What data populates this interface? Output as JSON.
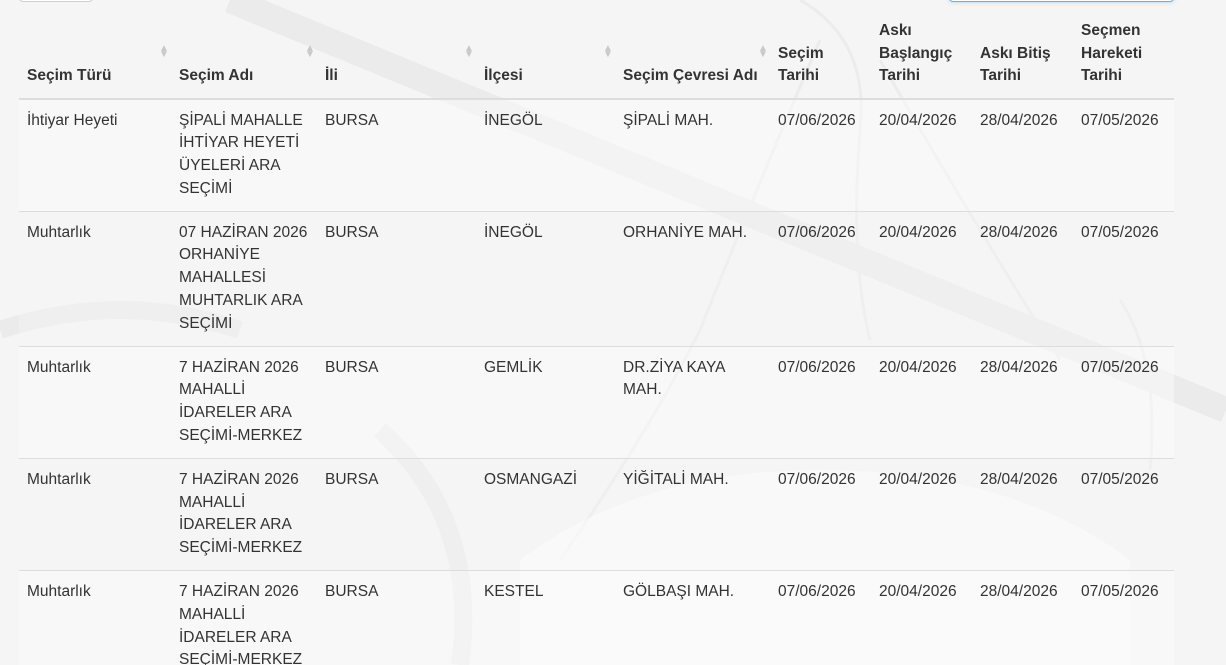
{
  "table": {
    "headers": [
      {
        "label": "Seçim Türü",
        "sortable": true
      },
      {
        "label": "Seçim Adı",
        "sortable": true
      },
      {
        "label": "İli",
        "sortable": true
      },
      {
        "label": "İlçesi",
        "sortable": true
      },
      {
        "label": "Seçim Çevresi Adı",
        "sortable": true
      },
      {
        "label": "Seçim Tarihi",
        "sortable": false
      },
      {
        "label": "Askı Başlangıç Tarihi",
        "sortable": false
      },
      {
        "label": "Askı Bitiş Tarihi",
        "sortable": false
      },
      {
        "label": "Seçmen Hareketi Tarihi",
        "sortable": false
      }
    ],
    "rows": [
      [
        "İhtiyar Heyeti",
        "ŞİPALİ MAHALLE İHTİYAR HEYETİ ÜYELERİ ARA SEÇİMİ",
        "BURSA",
        "İNEGÖL",
        "ŞİPALİ MAH.",
        "07/06/2026",
        "20/04/2026",
        "28/04/2026",
        "07/05/2026"
      ],
      [
        "Muhtarlık",
        "07 HAZİRAN 2026 ORHANİYE MAHALLESİ MUHTARLIK ARA SEÇİMİ",
        "BURSA",
        "İNEGÖL",
        "ORHANİYE MAH.",
        "07/06/2026",
        "20/04/2026",
        "28/04/2026",
        "07/05/2026"
      ],
      [
        "Muhtarlık",
        "7 HAZİRAN 2026 MAHALLİ İDARELER ARA SEÇİMİ-MERKEZ",
        "BURSA",
        "GEMLİK",
        "DR.ZİYA KAYA MAH.",
        "07/06/2026",
        "20/04/2026",
        "28/04/2026",
        "07/05/2026"
      ],
      [
        "Muhtarlık",
        "7 HAZİRAN 2026 MAHALLİ İDARELER ARA SEÇİMİ-MERKEZ",
        "BURSA",
        "OSMANGAZİ",
        "YİĞİTALİ MAH.",
        "07/06/2026",
        "20/04/2026",
        "28/04/2026",
        "07/05/2026"
      ],
      [
        "Muhtarlık",
        "7 HAZİRAN 2026 MAHALLİ İDARELER ARA SEÇİMİ-MERKEZ",
        "BURSA",
        "KESTEL",
        "GÖLBAŞI MAH.",
        "07/06/2026",
        "20/04/2026",
        "28/04/2026",
        "07/05/2026"
      ]
    ]
  },
  "icons": {
    "sort": "sort-icon"
  }
}
